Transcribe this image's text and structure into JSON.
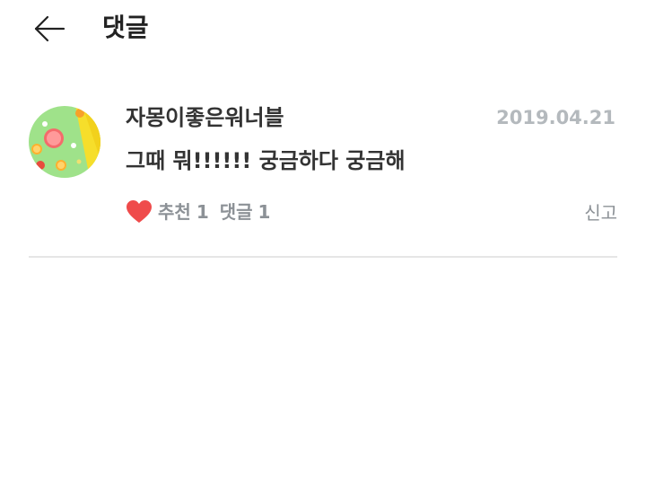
{
  "header": {
    "title": "댓글",
    "back_icon": "arrow-left-icon"
  },
  "comment": {
    "avatar": "citrus-fruit-avatar",
    "author": "자몽이좋은워너블",
    "date": "2019.04.21",
    "text": "그때 뭐!!!!!! 궁금하다 궁금해",
    "like_label": "추천",
    "like_count": "1",
    "reply_label": "댓글",
    "reply_count": "1",
    "report_label": "신고",
    "heart_icon": "heart-icon",
    "heart_color": "#ef4b4b"
  }
}
